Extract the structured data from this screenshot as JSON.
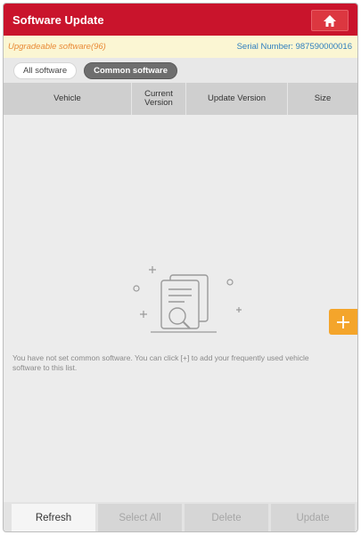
{
  "header": {
    "title": "Software Update",
    "home_icon": "home-icon"
  },
  "info": {
    "upgradeable": "Upgradeable software(96)",
    "serial_label": "Serial Number:",
    "serial_value": "987590000016"
  },
  "tabs": [
    {
      "label": "All software",
      "active": false
    },
    {
      "label": "Common software",
      "active": true
    }
  ],
  "table": {
    "columns": [
      "Vehicle",
      "Current Version",
      "Update Version",
      "Size"
    ]
  },
  "empty_state": {
    "message": "You have not set common software. You can click [+] to add your frequently used vehicle software to this list.",
    "icon": "documents-search-icon"
  },
  "add_button": {
    "icon": "plus-icon"
  },
  "bottom_bar": {
    "refresh": "Refresh",
    "select_all": "Select All",
    "delete": "Delete",
    "update": "Update"
  },
  "colors": {
    "title_bar": "#c9142c",
    "info_bar": "#fbf6d3",
    "accent_orange": "#f4a52b",
    "serial_blue": "#2f7fbf"
  }
}
